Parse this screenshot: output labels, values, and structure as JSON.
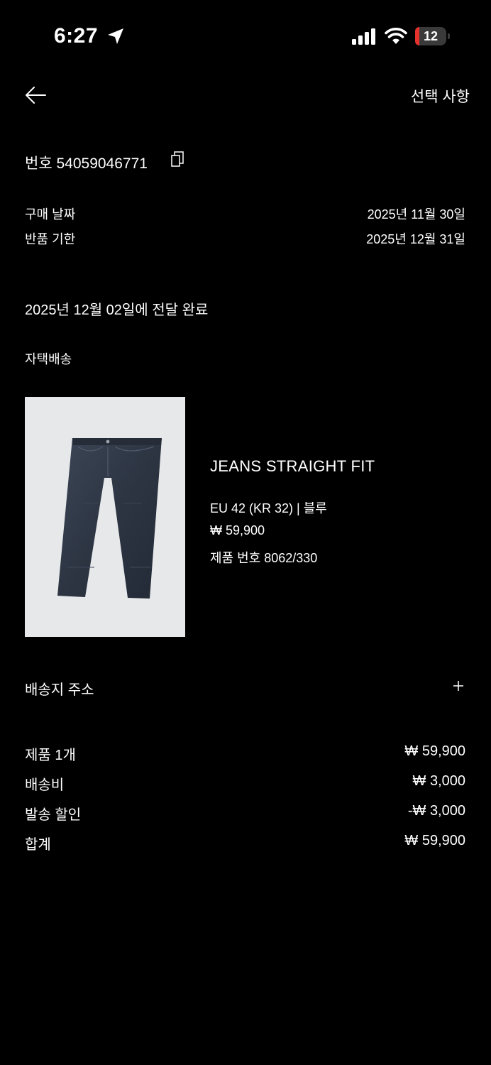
{
  "status_bar": {
    "time": "6:27",
    "battery": "12",
    "battery_level": 0.12
  },
  "header": {
    "options_label": "선택 사항"
  },
  "order": {
    "number_label": "번호 54059046771",
    "purchase_date_label": "구매 날짜",
    "purchase_date_value": "2025년 11월 30일",
    "return_deadline_label": "반품 기한",
    "return_deadline_value": "2025년 12월 31일",
    "delivery_status": "2025년 12월 02일에 전달 완료",
    "delivery_method": "자택배송"
  },
  "product": {
    "name": "JEANS STRAIGHT FIT",
    "size_color": "EU 42 (KR 32) | 블루",
    "price": "₩ 59,900",
    "product_number": "제품 번호 8062/330"
  },
  "address": {
    "label": "배송지 주소"
  },
  "summary": [
    {
      "label": "제품 1개",
      "value": "₩ 59,900"
    },
    {
      "label": "배송비",
      "value": "₩ 3,000"
    },
    {
      "label": "발송 할인",
      "value": "-₩ 3,000"
    },
    {
      "label": "합계",
      "value": "₩ 59,900"
    }
  ],
  "colors": {
    "background": "#000000",
    "text": "#ffffff",
    "battery_low": "#e5322d"
  },
  "icons": [
    "location-arrow-icon",
    "cellular-signal-icon",
    "wifi-icon",
    "battery-icon",
    "back-arrow-icon",
    "copy-icon",
    "plus-icon"
  ]
}
